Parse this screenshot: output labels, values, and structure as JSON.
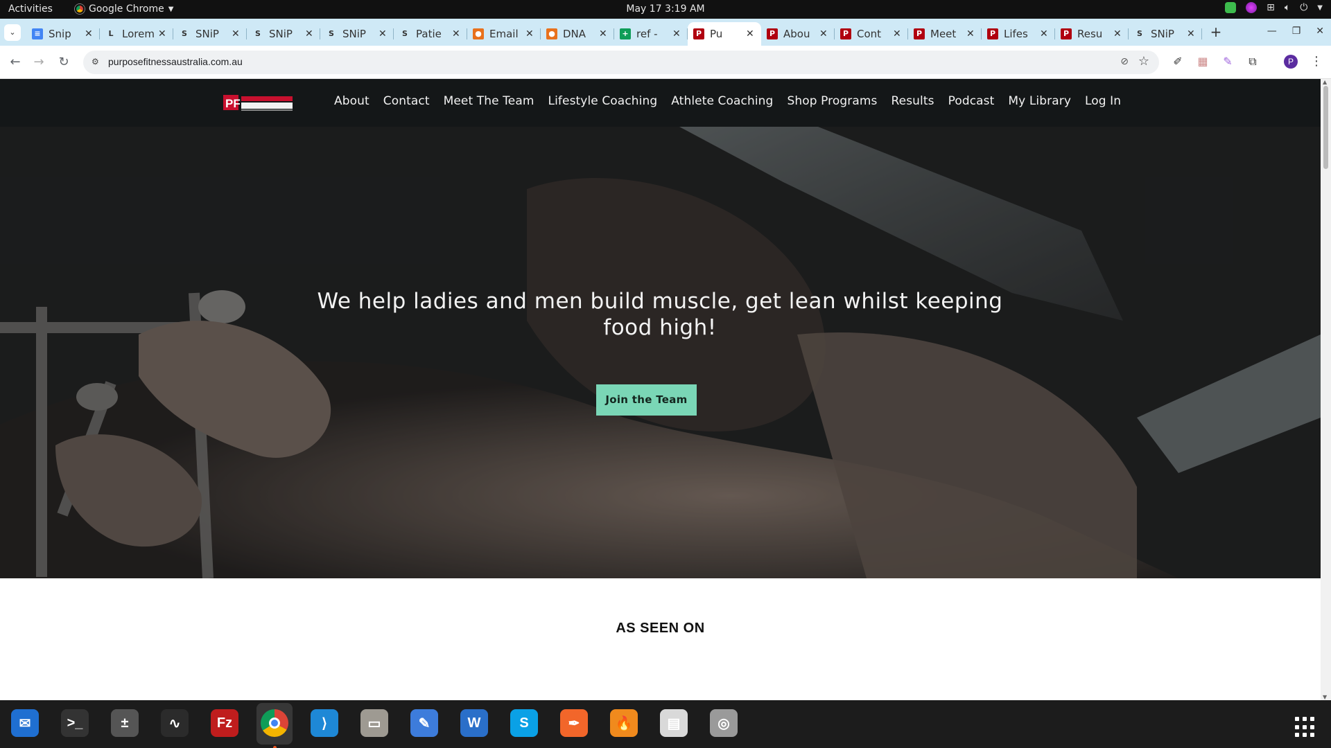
{
  "system": {
    "activities": "Activities",
    "app_name": "Google Chrome",
    "clock": "May 17  3:19 AM"
  },
  "browser": {
    "tabs": [
      {
        "title": "Snip",
        "icon": "docs-icon",
        "color": "#4285f4",
        "glyph": "≡"
      },
      {
        "title": "Lorem",
        "icon": "lorem-icon",
        "color": "#cfe9f6",
        "glyph": "L"
      },
      {
        "title": "SNiP",
        "icon": "snip-icon",
        "color": "#cfe9f6",
        "glyph": "S"
      },
      {
        "title": "SNiP",
        "icon": "snip-icon",
        "color": "#cfe9f6",
        "glyph": "S"
      },
      {
        "title": "SNiP",
        "icon": "snip-icon",
        "color": "#cfe9f6",
        "glyph": "S"
      },
      {
        "title": "Patie",
        "icon": "snip-icon",
        "color": "#cfe9f6",
        "glyph": "S"
      },
      {
        "title": "Email",
        "icon": "mail-icon",
        "color": "#e8711c",
        "glyph": "●"
      },
      {
        "title": "DNA",
        "icon": "mail-icon",
        "color": "#e8711c",
        "glyph": "●"
      },
      {
        "title": "ref -",
        "icon": "sheets-icon",
        "color": "#0f9d58",
        "glyph": "+"
      },
      {
        "title": "Pu",
        "icon": "purpose-fitness-icon",
        "color": "#b00010",
        "glyph": "P"
      },
      {
        "title": "Abou",
        "icon": "purpose-fitness-icon",
        "color": "#b00010",
        "glyph": "P"
      },
      {
        "title": "Cont",
        "icon": "purpose-fitness-icon",
        "color": "#b00010",
        "glyph": "P"
      },
      {
        "title": "Meet",
        "icon": "purpose-fitness-icon",
        "color": "#b00010",
        "glyph": "P"
      },
      {
        "title": "Lifes",
        "icon": "purpose-fitness-icon",
        "color": "#b00010",
        "glyph": "P"
      },
      {
        "title": "Resu",
        "icon": "purpose-fitness-icon",
        "color": "#b00010",
        "glyph": "P"
      },
      {
        "title": "SNiP",
        "icon": "snip-icon",
        "color": "#cfe9f6",
        "glyph": "S"
      }
    ],
    "active_tab_index": 9,
    "url": "purposefitnessaustralia.com.au",
    "profile_initial": "P"
  },
  "site": {
    "nav": [
      "About",
      "Contact",
      "Meet The Team",
      "Lifestyle Coaching",
      "Athlete Coaching",
      "Shop Programs",
      "Results",
      "Podcast",
      "My Library",
      "Log In"
    ],
    "hero": {
      "headline": "We help ladies and men build muscle, get lean whilst keeping food high!",
      "cta": "Join the Team",
      "cta_color": "#7ad6b6"
    },
    "seen_on_heading": "AS SEEN ON"
  },
  "dock": [
    {
      "name": "thunderbird-icon",
      "color": "#1f6fd1",
      "glyph": "✉"
    },
    {
      "name": "terminal-icon",
      "color": "#333333",
      "glyph": ">_"
    },
    {
      "name": "calculator-icon",
      "color": "#555555",
      "glyph": "±"
    },
    {
      "name": "system-monitor-icon",
      "color": "#2b2b2b",
      "glyph": "∿"
    },
    {
      "name": "filezilla-icon",
      "color": "#bf1d1d",
      "glyph": "Fz"
    },
    {
      "name": "chrome-icon",
      "color": "#3b7be0",
      "glyph": "◉"
    },
    {
      "name": "vscode-icon",
      "color": "#1e88d6",
      "glyph": "⟩"
    },
    {
      "name": "files-icon",
      "color": "#9e9a92",
      "glyph": "▭"
    },
    {
      "name": "text-editor-icon",
      "color": "#3d7cdb",
      "glyph": "✎"
    },
    {
      "name": "libreoffice-writer-icon",
      "color": "#2a6fc9",
      "glyph": "W"
    },
    {
      "name": "skype-icon",
      "color": "#0aa1e6",
      "glyph": "S"
    },
    {
      "name": "inkscape-icon",
      "color": "#f2662a",
      "glyph": "✒"
    },
    {
      "name": "firefox-dev-icon",
      "color": "#f08a1d",
      "glyph": "🔥"
    },
    {
      "name": "document-viewer-icon",
      "color": "#d9d9d9",
      "glyph": "▤"
    },
    {
      "name": "disk-icon",
      "color": "#9a9a9a",
      "glyph": "◎"
    }
  ]
}
